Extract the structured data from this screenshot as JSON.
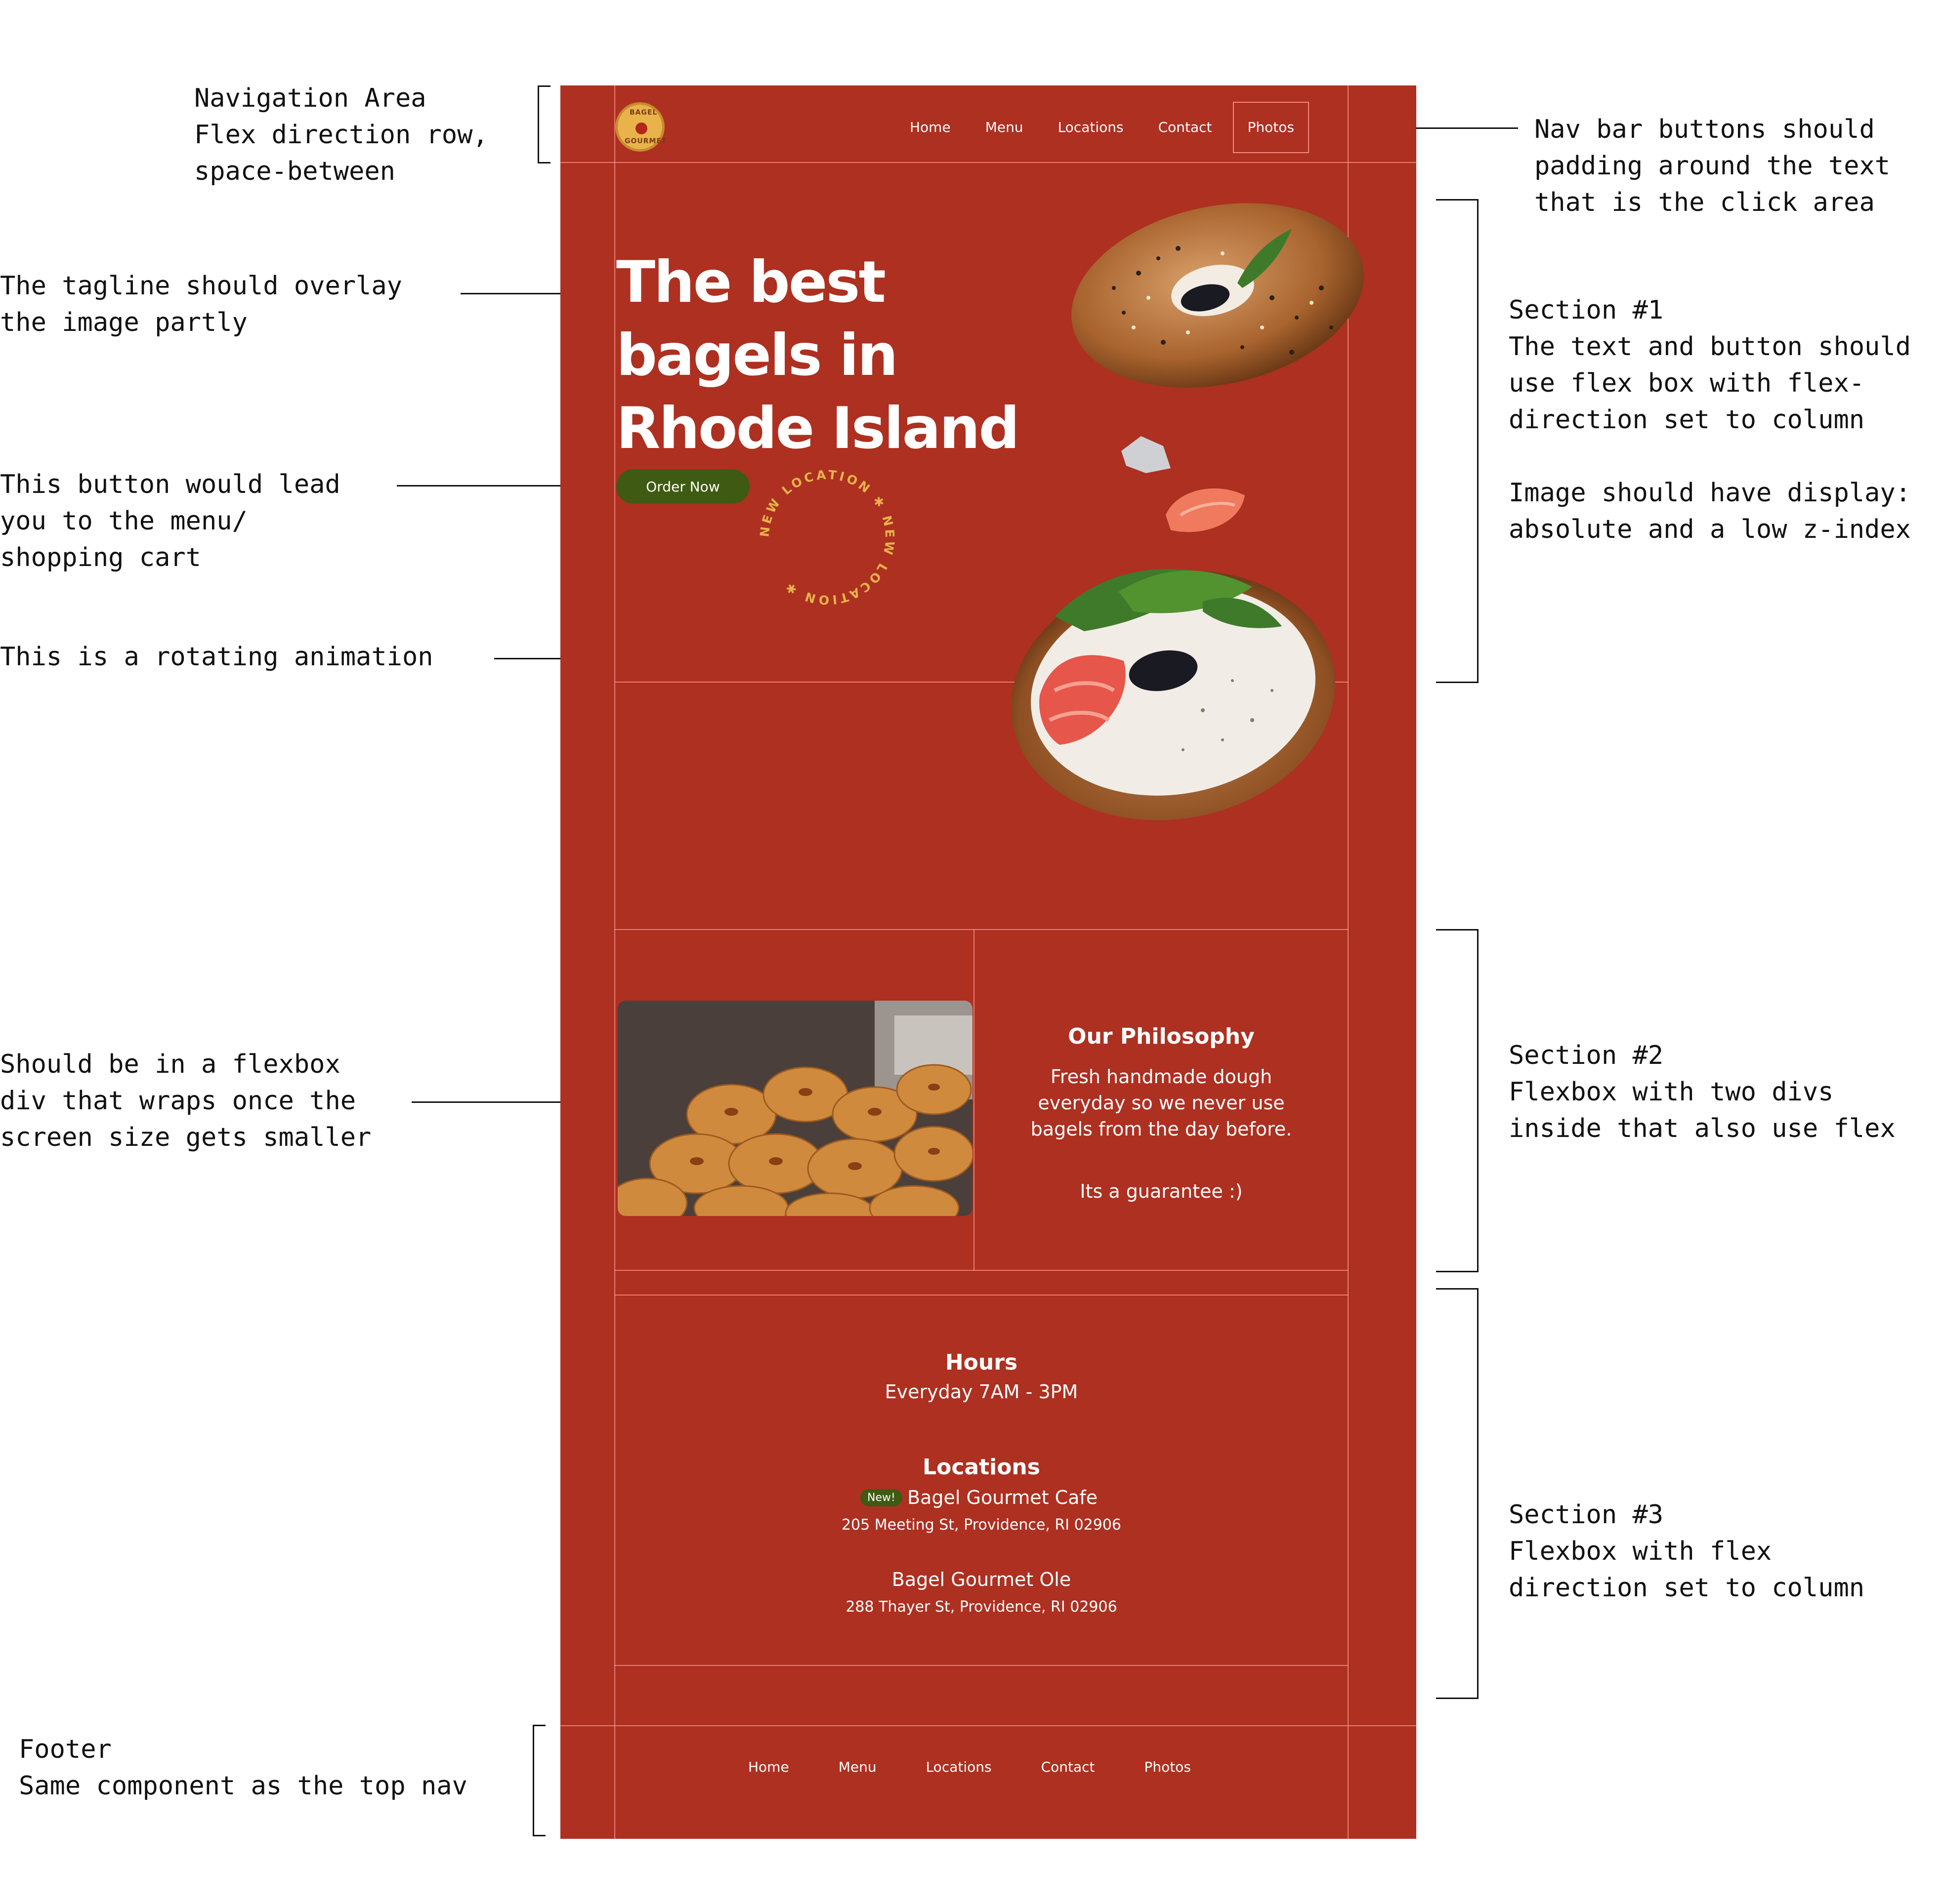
{
  "annotations": {
    "nav_area": "Navigation Area\nFlex direction row,\nspace-between",
    "tagline": "The tagline should overlay\nthe image partly",
    "button": "This button would lead\nyou to the menu/\nshopping cart",
    "rotating": "This is a rotating animation",
    "flexbox_wrap": "Should be in a flexbox\ndiv that wraps once the\nscreen size gets smaller",
    "footer": "Footer\nSame component as the top nav",
    "nav_buttons": "Nav bar buttons should\npadding around the text\nthat is the click area",
    "section1": "Section #1\nThe text and button should\nuse flex box with flex-\ndirection set to column\n\nImage should have display:\nabsolute and a low z-index",
    "section2": "Section #2\nFlexbox with two divs\ninside that also use flex",
    "section3": "Section #3\nFlexbox with flex\ndirection set to column"
  },
  "site": {
    "colors": {
      "background": "#ad3021",
      "button": "#3f5a12",
      "ring_text": "#e8b34b",
      "guide": "#ff968c"
    },
    "logo": {
      "line1": "BAGEL",
      "line2": "GOURMET"
    },
    "nav": [
      "Home",
      "Menu",
      "Locations",
      "Contact",
      "Photos"
    ],
    "hero": {
      "headline": [
        "The best",
        "bagels in",
        "Rhode Island"
      ],
      "order_button": "Order Now",
      "ring_text": "NEW LOCATION ✱ NEW LOCATION ✱ "
    },
    "philosophy": {
      "title": "Our Philosophy",
      "lines": [
        "Fresh handmade dough",
        "everyday so we never use",
        "bagels from the day before."
      ],
      "guarantee": "Its a guarantee :)"
    },
    "hours": {
      "title": "Hours",
      "text": "Everyday 7AM - 3PM"
    },
    "locations": {
      "title": "Locations",
      "items": [
        {
          "badge": "New!",
          "name": "Bagel Gourmet Cafe",
          "address": "205 Meeting St, Providence, RI 02906"
        },
        {
          "name": "Bagel Gourmet Ole",
          "address": "288 Thayer St, Providence, RI 02906"
        }
      ]
    },
    "footer_nav": [
      "Home",
      "Menu",
      "Locations",
      "Contact",
      "Photos"
    ]
  }
}
